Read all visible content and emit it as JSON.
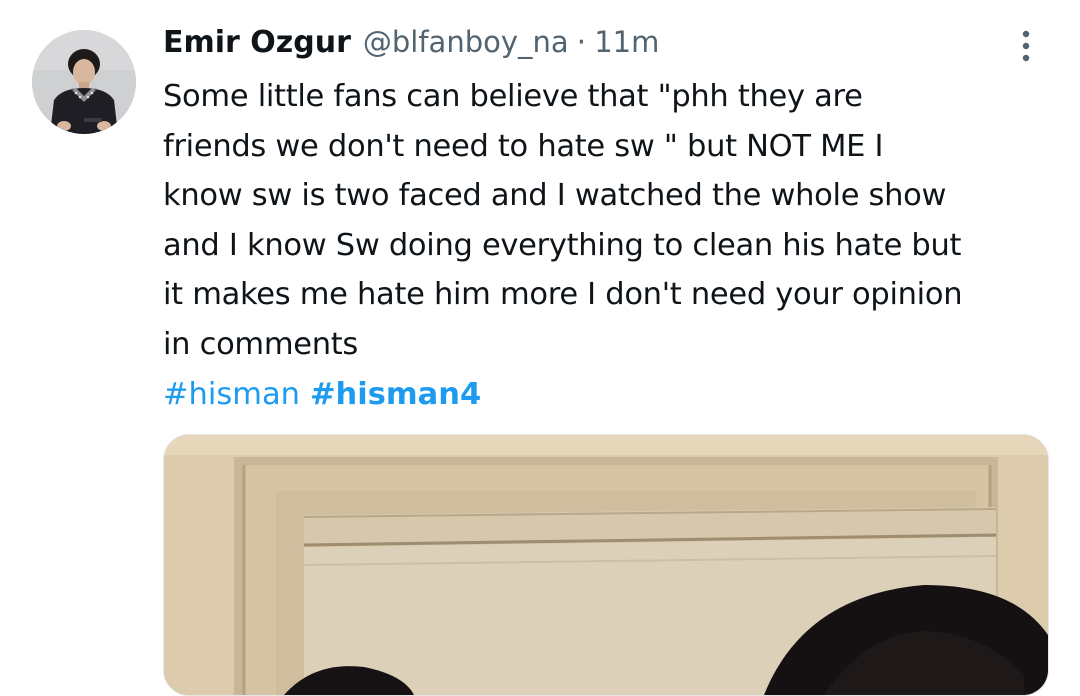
{
  "tweet": {
    "author": {
      "display_name": "Emir Ozgur",
      "handle": "@blfanboy_na"
    },
    "separator": "·",
    "time": "11m",
    "text_lines": [
      "Some little fans can believe that \"phh they are",
      "friends we don't need to hate sw \" but NOT ME I",
      "know sw is two faced and I watched the whole show",
      "and I know Sw doing everything to clean his hate but",
      "it makes me hate him more I don't need your opinion",
      "in comments"
    ],
    "hashtags": [
      "#hisman",
      "#hisman4"
    ]
  },
  "colors": {
    "link": "#1d9bf0",
    "secondary_text": "#536471",
    "primary_text": "#0f1419"
  },
  "icons": {
    "more": "more-vertical-icon"
  }
}
